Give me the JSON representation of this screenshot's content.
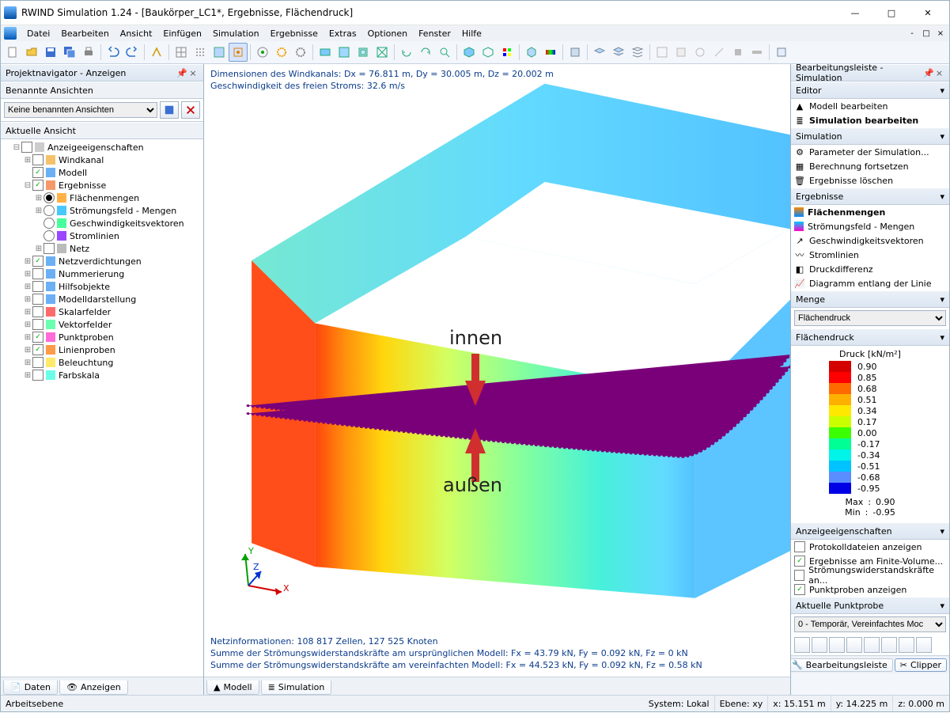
{
  "title": "RWIND Simulation 1.24 - [Baukörper_LC1*, Ergebnisse, Flächendruck]",
  "menu": {
    "items": [
      "Datei",
      "Bearbeiten",
      "Ansicht",
      "Einfügen",
      "Simulation",
      "Ergebnisse",
      "Extras",
      "Optionen",
      "Fenster",
      "Hilfe"
    ]
  },
  "nav": {
    "title": "Projektnavigator - Anzeigen",
    "named": {
      "label": "Benannte Ansichten",
      "select": "Keine benannten Ansichten"
    },
    "view": {
      "label": "Aktuelle Ansicht"
    },
    "tree": [
      {
        "ind": 1,
        "tw": "-",
        "cb": "",
        "lbl": "Anzeigeeigenschaften"
      },
      {
        "ind": 2,
        "tw": "+",
        "cb": "",
        "lbl": "Windkanal",
        "ic": "wind"
      },
      {
        "ind": 2,
        "tw": "",
        "cb": "✓",
        "lbl": "Modell",
        "ic": "model"
      },
      {
        "ind": 2,
        "tw": "-",
        "cb": "✓",
        "lbl": "Ergebnisse",
        "ic": "res"
      },
      {
        "ind": 3,
        "tw": "+",
        "cbrad": true,
        "sel": true,
        "lbl": "Flächenmengen",
        "ic": "fm"
      },
      {
        "ind": 3,
        "tw": "+",
        "cbrad": true,
        "lbl": "Strömungsfeld - Mengen",
        "ic": "sf"
      },
      {
        "ind": 3,
        "tw": "",
        "cbrad": true,
        "lbl": "Geschwindigkeitsvektoren",
        "ic": "vec"
      },
      {
        "ind": 3,
        "tw": "",
        "cbrad": true,
        "lbl": "Stromlinien",
        "ic": "sl"
      },
      {
        "ind": 3,
        "tw": "+",
        "cb": "",
        "lbl": "Netz",
        "ic": "mesh"
      },
      {
        "ind": 2,
        "tw": "+",
        "cb": "✓",
        "lbl": "Netzverdichtungen",
        "ic": "nv"
      },
      {
        "ind": 2,
        "tw": "+",
        "cb": "",
        "lbl": "Nummerierung",
        "ic": "num"
      },
      {
        "ind": 2,
        "tw": "+",
        "cb": "",
        "lbl": "Hilfsobjekte",
        "ic": "help"
      },
      {
        "ind": 2,
        "tw": "+",
        "cb": "",
        "lbl": "Modelldarstellung",
        "ic": "md"
      },
      {
        "ind": 2,
        "tw": "+",
        "cb": "",
        "lbl": "Skalarfelder",
        "ic": "sk"
      },
      {
        "ind": 2,
        "tw": "+",
        "cb": "",
        "lbl": "Vektorfelder",
        "ic": "vf"
      },
      {
        "ind": 2,
        "tw": "+",
        "cb": "✓",
        "lbl": "Punktproben",
        "ic": "pp"
      },
      {
        "ind": 2,
        "tw": "+",
        "cb": "✓",
        "lbl": "Linienproben",
        "ic": "lp"
      },
      {
        "ind": 2,
        "tw": "+",
        "cb": "",
        "lbl": "Beleuchtung",
        "ic": "lt"
      },
      {
        "ind": 2,
        "tw": "+",
        "cb": "",
        "lbl": "Farbskala",
        "ic": "cs"
      }
    ],
    "tabs": {
      "data": "Daten",
      "show": "Anzeigen"
    }
  },
  "center": {
    "t1": "Dimensionen des Windkanals: Dx = 76.811 m, Dy = 30.005 m, Dz = 20.002 m",
    "t2": "Geschwindigkeit des freien Stroms: 32.6 m/s",
    "b1": "Netzinformationen: 108 817 Zellen, 127 525 Knoten",
    "b2": "Summe der Strömungswiderstandskräfte am ursprünglichen Modell: Fx = 43.79 kN, Fy = 0.092 kN, Fz = 0 kN",
    "b3": "Summe der Strömungswiderstandskräfte am vereinfachten Modell: Fx = 44.523 kN, Fy = 0.092 kN, Fz = 0.58 kN",
    "ann": {
      "inner": "innen",
      "outer": "außen"
    },
    "tabs": {
      "model": "Modell",
      "sim": "Simulation"
    }
  },
  "right": {
    "title": "Bearbeitungsleiste - Simulation",
    "editor": {
      "hd": "Editor",
      "items": [
        "Modell bearbeiten",
        "Simulation bearbeiten"
      ]
    },
    "sim": {
      "hd": "Simulation",
      "items": [
        "Parameter der Simulation...",
        "Berechnung fortsetzen",
        "Ergebnisse löschen"
      ]
    },
    "res": {
      "hd": "Ergebnisse",
      "items": [
        "Flächenmengen",
        "Strömungsfeld - Mengen",
        "Geschwindigkeitsvektoren",
        "Stromlinien",
        "Druckdifferenz",
        "Diagramm entlang der Linie"
      ]
    },
    "menge": {
      "hd": "Menge",
      "sel": "Flächendruck"
    },
    "scale": {
      "hd": "Flächendruck",
      "title": "Druck [kN/m²]",
      "rows": [
        {
          "c": "#d40000",
          "v": "0.90"
        },
        {
          "c": "#ff0000",
          "v": "0.85"
        },
        {
          "c": "#ff6a00",
          "v": "0.68"
        },
        {
          "c": "#ffb000",
          "v": "0.51"
        },
        {
          "c": "#ffe800",
          "v": "0.34"
        },
        {
          "c": "#caff00",
          "v": "0.17"
        },
        {
          "c": "#3bff00",
          "v": "0.00"
        },
        {
          "c": "#00ff95",
          "v": "-0.17"
        },
        {
          "c": "#00f4e8",
          "v": "-0.34"
        },
        {
          "c": "#00c3ff",
          "v": "-0.51"
        },
        {
          "c": "#5a8dff",
          "v": "-0.68"
        },
        {
          "c": "#0000e6",
          "v": "-0.95"
        }
      ],
      "max": "0.90",
      "min": "-0.95",
      "maxlbl": "Max",
      "minlbl": "Min"
    },
    "disp": {
      "hd": "Anzeigeeigenschaften",
      "items": [
        {
          "chk": false,
          "lbl": "Protokolldateien anzeigen"
        },
        {
          "chk": true,
          "lbl": "Ergebnisse am Finite-Volume..."
        },
        {
          "chk": false,
          "lbl": "Strömungswiderstandskräfte an..."
        },
        {
          "chk": true,
          "lbl": "Punktproben anzeigen"
        }
      ]
    },
    "probe": {
      "hd": "Aktuelle Punktprobe",
      "sel": "0 - Temporär, Vereinfachtes Moc"
    },
    "tabs": {
      "bar": "Bearbeitungsleiste",
      "clip": "Clipper"
    }
  },
  "status": {
    "work": "Arbeitsebene",
    "sys": "System: Lokal",
    "plane": "Ebene: xy",
    "x": "x: 15.151 m",
    "y": "y: 14.225 m",
    "z": "z: 0.000 m"
  }
}
